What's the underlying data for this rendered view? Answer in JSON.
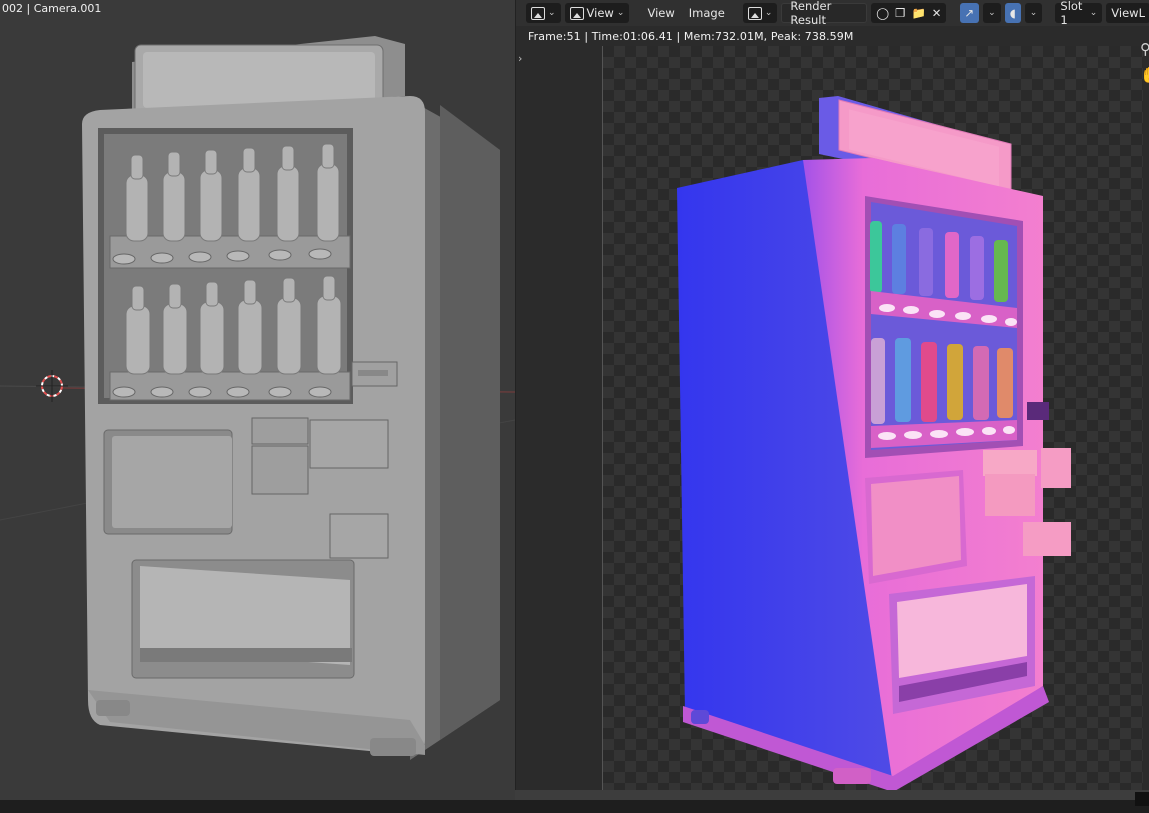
{
  "viewport": {
    "title": "002 | Camera.001"
  },
  "image_editor": {
    "header": {
      "editor_type_icon": "image-editor-icon",
      "view_menu_1": "View",
      "view_menu_2": "View",
      "image_menu": "Image",
      "image_browse_icon": "image-browse-icon",
      "image_name": "Render Result",
      "icons": [
        "fake-user-shield-icon",
        "duplicate-icon",
        "open-folder-icon",
        "close-icon"
      ],
      "gizmo_icon": "gizmo-arrows-icon",
      "overlay_icon": "overlay-icon",
      "slot": "Slot 1",
      "view_layer": "ViewL"
    },
    "render_info": "Frame:51 | Time:01:06.41 | Mem:732.01M, Peak: 738.59M",
    "colors": {
      "render_left": "#3a3ef0",
      "render_right": "#f07ad8",
      "header_bg": "#303030",
      "accent": "#4772b3"
    }
  }
}
